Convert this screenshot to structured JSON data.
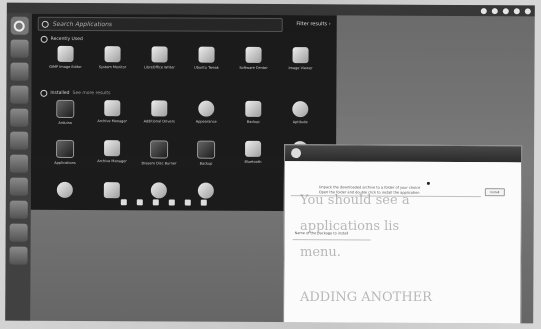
{
  "dash": {
    "search_placeholder": "Search Applications",
    "filter_label": "Filter results",
    "recent": {
      "header": "Recently Used",
      "apps": [
        {
          "label": "GIMP Image Editor",
          "icon": "gimp-icon"
        },
        {
          "label": "System Monitor",
          "icon": "monitor-icon"
        },
        {
          "label": "LibreOffice Writer",
          "icon": "writer-icon"
        },
        {
          "label": "Ubuntu Tweak",
          "icon": "tweak-icon"
        },
        {
          "label": "Software Center",
          "icon": "software-icon"
        },
        {
          "label": "Image Viewer",
          "icon": "image-viewer-icon"
        }
      ]
    },
    "installed": {
      "header": "Installed",
      "more": "See more results",
      "apps_row1": [
        {
          "label": "Arduino",
          "icon": "arduino-icon"
        },
        {
          "label": "Archive Manager",
          "icon": "archive-icon"
        },
        {
          "label": "Additional Drivers",
          "icon": "drivers-icon"
        },
        {
          "label": "Appearance",
          "icon": "appearance-icon"
        },
        {
          "label": "Backup",
          "icon": "backup-icon"
        },
        {
          "label": "Aptitude",
          "icon": "aptitude-icon"
        }
      ],
      "apps_row2": [
        {
          "label": "Applications",
          "icon": "apps-icon"
        },
        {
          "label": "Archive Manager",
          "icon": "archive2-icon"
        },
        {
          "label": "Brasero Disc Burner",
          "icon": "brasero-icon"
        },
        {
          "label": "Backup",
          "icon": "backup2-icon"
        },
        {
          "label": "Bluetooth",
          "icon": "bluetooth-icon"
        },
        {
          "label": "Calculator",
          "icon": "calculator-icon"
        }
      ]
    }
  },
  "window": {
    "line1": "Unpack the downloaded archive to a folder of your choice",
    "line2": "Open the folder and double click to install the application",
    "field_label": "Name of the package to install",
    "button": "Install"
  },
  "ghost_text": [
    "You should see a",
    "applications lis",
    "menu.",
    "ADDING ANOTHER"
  ]
}
